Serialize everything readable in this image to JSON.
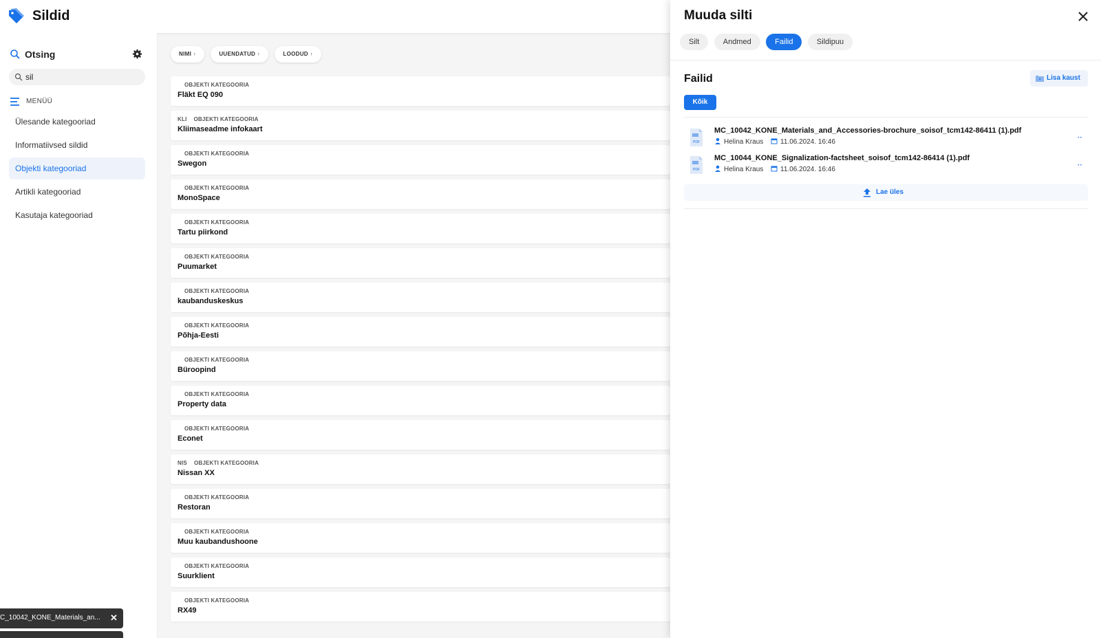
{
  "app": {
    "title": "Sildid",
    "accent_color": "#1a73e8"
  },
  "sidebar": {
    "search_label": "Otsing",
    "search_value": "sil",
    "menu_label": "MENÜÜ",
    "items": [
      {
        "label": "Ülesande kategooriad",
        "active": false
      },
      {
        "label": "Informatiivsed sildid",
        "active": false
      },
      {
        "label": "Objekti kategooriad",
        "active": true
      },
      {
        "label": "Artikli kategooriad",
        "active": false
      },
      {
        "label": "Kasutaja kategooriad",
        "active": false
      }
    ]
  },
  "sort": {
    "name": "NIMI",
    "updated": "UUENDATUD",
    "created": "LOODUD",
    "arrow": "↑"
  },
  "list": {
    "rows": [
      {
        "code": "",
        "category": "OBJEKTI KATEGOORIA",
        "name": "Fläkt EQ 090"
      },
      {
        "code": "KLI",
        "category": "OBJEKTI KATEGOORIA",
        "name": "Kliimaseadme infokaart"
      },
      {
        "code": "",
        "category": "OBJEKTI KATEGOORIA",
        "name": "Swegon"
      },
      {
        "code": "",
        "category": "OBJEKTI KATEGOORIA",
        "name": "MonoSpace"
      },
      {
        "code": "",
        "category": "OBJEKTI KATEGOORIA",
        "name": "Tartu piirkond"
      },
      {
        "code": "",
        "category": "OBJEKTI KATEGOORIA",
        "name": "Puumarket"
      },
      {
        "code": "",
        "category": "OBJEKTI KATEGOORIA",
        "name": "kaubanduskeskus"
      },
      {
        "code": "",
        "category": "OBJEKTI KATEGOORIA",
        "name": "Põhja-Eesti"
      },
      {
        "code": "",
        "category": "OBJEKTI KATEGOORIA",
        "name": "Büroopind"
      },
      {
        "code": "",
        "category": "OBJEKTI KATEGOORIA",
        "name": "Property data"
      },
      {
        "code": "",
        "category": "OBJEKTI KATEGOORIA",
        "name": "Econet"
      },
      {
        "code": "NIS",
        "category": "OBJEKTI KATEGOORIA",
        "name": "Nissan XX"
      },
      {
        "code": "",
        "category": "OBJEKTI KATEGOORIA",
        "name": "Restoran"
      },
      {
        "code": "",
        "category": "OBJEKTI KATEGOORIA",
        "name": "Muu kaubandushoone"
      },
      {
        "code": "",
        "category": "OBJEKTI KATEGOORIA",
        "name": "Suurklient"
      },
      {
        "code": "",
        "category": "OBJEKTI KATEGOORIA",
        "name": "RX49"
      }
    ]
  },
  "drawer": {
    "title": "Muuda silti",
    "tabs": [
      {
        "label": "Silt",
        "active": false
      },
      {
        "label": "Andmed",
        "active": false
      },
      {
        "label": "Failid",
        "active": true
      },
      {
        "label": "Sildipuu",
        "active": false
      }
    ],
    "section_title": "Failid",
    "add_folder_label": "Lisa kaust",
    "filter_all_label": "Kõik",
    "files": [
      {
        "name": "MC_10042_KONE_Materials_and_Accessories-brochure_soisof_tcm142-86411 (1).pdf",
        "author": "Helina Kraus",
        "date": "11.06.2024. 16:46",
        "icon": "pdf-file-icon"
      },
      {
        "name": "MC_10044_KONE_Signalization-factsheet_soisof_tcm142-86414 (1).pdf",
        "author": "Helina Kraus",
        "date": "11.06.2024. 16:46",
        "icon": "pdf-file-icon"
      }
    ],
    "more_label": "··",
    "upload_label": "Lae üles"
  },
  "toast": {
    "filename": "C_10042_KONE_Materials_an...",
    "close": "✕"
  }
}
